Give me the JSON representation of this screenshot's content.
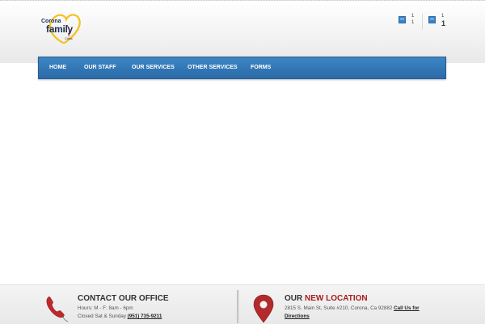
{
  "header": {
    "logo": {
      "top_text": "Corona",
      "main_text": "family",
      "sub_text": "Clinic"
    },
    "counters": [
      {
        "icon": "calendar-icon",
        "line1": "1",
        "line2": "1"
      },
      {
        "icon": "calendar-icon",
        "line1": "1",
        "line2": "1"
      }
    ]
  },
  "nav": {
    "items": [
      {
        "label": "HOME"
      },
      {
        "label": "OUR STAFF"
      },
      {
        "label": "OUR SERVICES"
      },
      {
        "label": "OTHER SERVICES"
      },
      {
        "label": "FORMS"
      }
    ]
  },
  "footer": {
    "contact": {
      "title": "CONTACT OUR OFFICE",
      "hours": "Hours: M - F: 8am - 6pm",
      "closed": "Closed Sat & Sunday",
      "phone": "(951) 735-9211"
    },
    "location": {
      "title_prefix": "OUR",
      "title_highlight": "NEW LOCATION",
      "address": "2815 S. Main St, Suite #210, Corona, Ca 92882",
      "link_part1": "Call Us for",
      "link_part2": "Directions"
    }
  },
  "colors": {
    "nav_blue": "#2f72b4",
    "accent_red": "#a81d1d",
    "logo_gold": "#f2c21b",
    "logo_navy": "#1d2f4f"
  }
}
